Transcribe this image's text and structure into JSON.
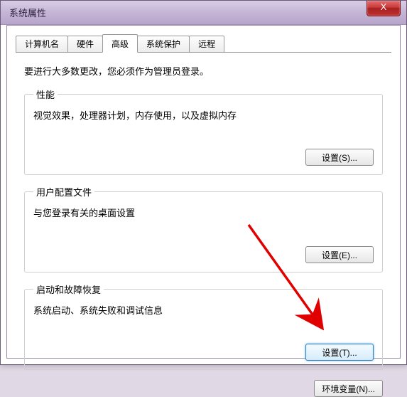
{
  "window": {
    "title": "系统属性",
    "close_label": "X"
  },
  "tabs": {
    "t0": "计算机名",
    "t1": "硬件",
    "t2": "高级",
    "t3": "系统保护",
    "t4": "远程"
  },
  "page": {
    "intro": "要进行大多数更改，您必须作为管理员登录。",
    "perf": {
      "legend": "性能",
      "desc": "视觉效果，处理器计划，内存使用，以及虚拟内存",
      "button": "设置(S)..."
    },
    "profiles": {
      "legend": "用户配置文件",
      "desc": "与您登录有关的桌面设置",
      "button": "设置(E)..."
    },
    "startup": {
      "legend": "启动和故障恢复",
      "desc": "系统启动、系统失败和调试信息",
      "button": "设置(T)..."
    },
    "env_button": "环境变量(N)..."
  }
}
